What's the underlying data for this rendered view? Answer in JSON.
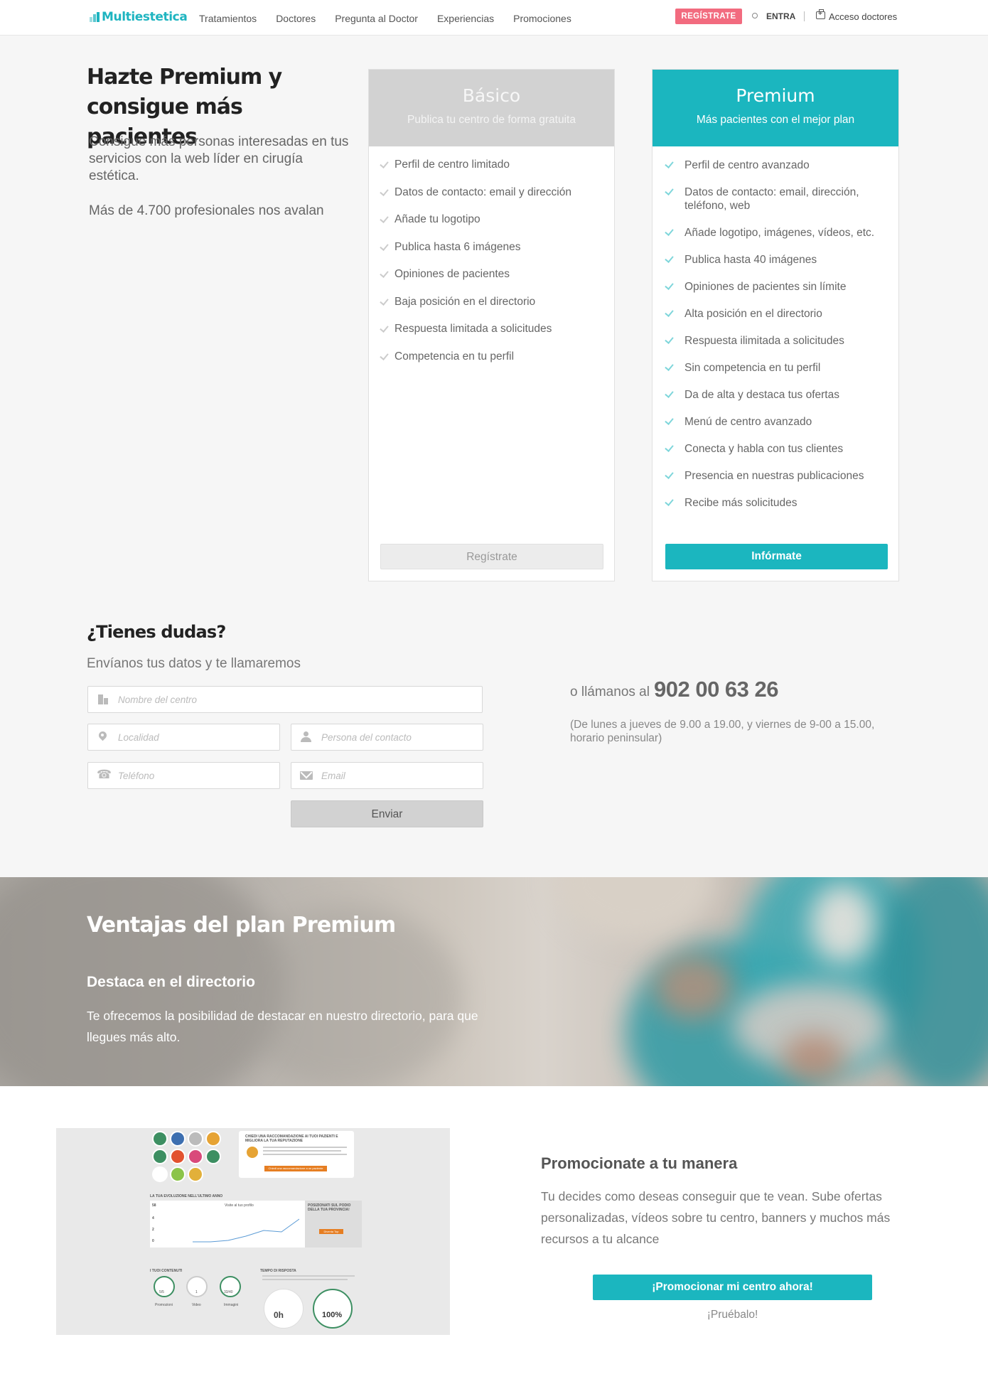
{
  "header": {
    "logo": "Multiestetica",
    "nav": [
      "Tratamientos",
      "Doctores",
      "Pregunta al Doctor",
      "Experiencias",
      "Promociones"
    ],
    "register": "REGÍSTRATE",
    "login": "ENTRA",
    "doctors_access": "Acceso doctores"
  },
  "hero": {
    "title": "Hazte Premium y consigue más pacientes",
    "subtitle": "Consigue más personas interesadas en tus servicios con la web líder en cirugía estética.",
    "count": "Más de 4.700 profesionales nos avalan"
  },
  "plans": {
    "basic": {
      "name": "Básico",
      "tagline": "Publica tu centro de forma gratuita",
      "features": [
        "Perfil de centro limitado",
        "Datos de contacto: email y dirección",
        "Añade tu logotipo",
        "Publica hasta 6 imágenes",
        "Opiniones de pacientes",
        "Baja posición en el directorio",
        "Respuesta limitada a solicitudes",
        "Competencia en tu perfil"
      ],
      "button": "Regístrate"
    },
    "premium": {
      "name": "Premium",
      "tagline": "Más pacientes con el mejor plan",
      "features": [
        "Perfil de centro avanzado",
        "Datos de contacto: email, dirección, teléfono, web",
        "Añade logotipo, imágenes, vídeos, etc.",
        "Publica hasta 40 imágenes",
        "Opiniones de pacientes sin límite",
        "Alta posición en el directorio",
        "Respuesta ilimitada a solicitudes",
        "Sin competencia en tu perfil",
        "Da de alta y destaca tus ofertas",
        "Menú de centro avanzado",
        "Conecta y habla con tus clientes",
        "Presencia en nuestras publicaciones",
        "Recibe más solicitudes"
      ],
      "button": "Infórmate"
    }
  },
  "contact": {
    "title": "¿Tienes dudas?",
    "subtitle": "Envíanos tus datos y te llamaremos",
    "fields": {
      "center": "Nombre del centro",
      "city": "Localidad",
      "person": "Persona del contacto",
      "phone": "Teléfono",
      "email": "Email"
    },
    "send": "Enviar",
    "call_prefix": "o llámanos al",
    "phone_number": "902 00 63 26",
    "hours": "(De lunes a jueves de 9.00 a 19.00, y viernes de 9-00 a 15.00, horario peninsular)"
  },
  "banner": {
    "title": "Ventajas del plan Premium",
    "subtitle": "Destaca en el directorio",
    "text": "Te ofrecemos la posibilidad de destacar en nuestro directorio, para que llegues más alto."
  },
  "promo": {
    "title": "Promocionate a tu manera",
    "text": "Tu decides como deseas conseguir que te vean. Sube ofertas personalizadas, vídeos sobre tu centro, banners y muchos más recursos a tu alcance",
    "button": "¡Promocionar mi centro ahora!",
    "try": "¡Pruébalo!",
    "mockup": {
      "recommend_title": "CHIEDI UNA RACCOMANDAZIONE AI TUOI PAZIENTI E MIGLIORA LA TUA REPUTAZIONE",
      "recommend_btn": "Chiedi una raccomandazione a un paziente",
      "evolution": "LA TUA EVOLUZIONE NELL'ULTIMO ANNO",
      "visits": "Visite al tuo profilo",
      "position": "POSIZIONATI SUL PODIO DELLA TUA PROVINCIA!",
      "position_btn": "Diventa Top",
      "contents": "I TUOI CONTENUTI",
      "response": "TEMPO DI RISPOSTA",
      "resp_time": "0h",
      "resp_pct": "100%",
      "stats": [
        "58",
        "4",
        "2",
        "0"
      ],
      "content_vals": [
        "5/5",
        "1",
        "33/40"
      ],
      "content_labels": [
        "Promozioni",
        "Video",
        "Immagini"
      ]
    }
  },
  "colors": {
    "brand": "#1bb6bf",
    "register": "#f26b7f"
  }
}
